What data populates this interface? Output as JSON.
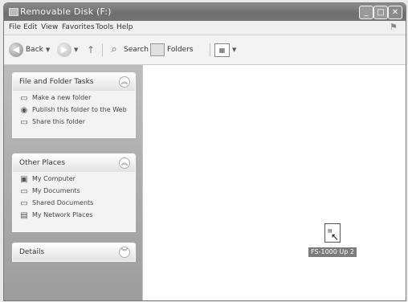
{
  "window": {
    "title": "Removable Disk (F:)"
  },
  "menubar": {
    "items": [
      "File",
      "Edit",
      "View",
      "Favorites",
      "Tools",
      "Help"
    ]
  },
  "toolbar": {
    "back_label": "Back",
    "search_label": "Search",
    "folders_label": "Folders"
  },
  "sidebar": {
    "file_folder_tasks": {
      "title": "File and Folder Tasks",
      "items": [
        "Make a new folder",
        "Publish this folder to the Web",
        "Share this folder"
      ]
    },
    "other_places": {
      "title": "Other Places",
      "items": [
        "My Computer",
        "My Documents",
        "Shared Documents",
        "My Network Places"
      ]
    },
    "details": {
      "title": "Details"
    }
  },
  "content": {
    "file_label": "FS-1000 Up 2"
  },
  "icons": {
    "app": "folder-icon",
    "back": "back-arrow-icon",
    "forward": "forward-arrow-icon",
    "up": "up-folder-icon",
    "search": "search-icon",
    "folders": "folders-icon",
    "views": "views-icon"
  }
}
